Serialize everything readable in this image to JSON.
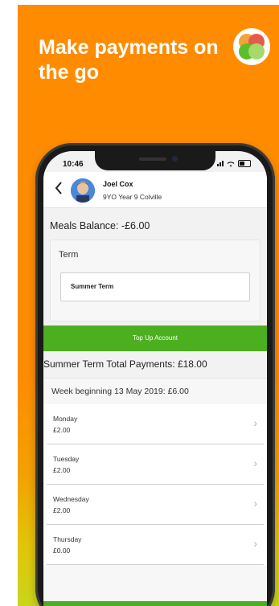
{
  "poster": {
    "headline": "Make payments on the go",
    "background_color": "#ff8c00"
  },
  "status_bar": {
    "time": "10:46"
  },
  "header": {
    "back_icon": "chevron-left-icon",
    "student_name": "Joel Cox",
    "student_info": "9YO  Year 9  Colville"
  },
  "balance": {
    "text": "Meals Balance: -£6.00"
  },
  "term": {
    "label": "Term",
    "selected": "Summer Term"
  },
  "topup": {
    "label": "Top Up Account",
    "color": "#4caf1f"
  },
  "summary": {
    "total_text": "Summer Term Total Payments: £18.00"
  },
  "week": {
    "title": "Week beginning 13 May 2019: £6.00",
    "days": [
      {
        "name": "Monday",
        "amount": "£2.00"
      },
      {
        "name": "Tuesday",
        "amount": "£2.00"
      },
      {
        "name": "Wednesday",
        "amount": "£2.00"
      },
      {
        "name": "Thursday",
        "amount": "£0.00"
      }
    ]
  },
  "tabbar": {
    "items": [
      {
        "icon": "menu-icon"
      },
      {
        "icon": "logo-icon"
      },
      {
        "icon": "user-icon"
      }
    ]
  }
}
